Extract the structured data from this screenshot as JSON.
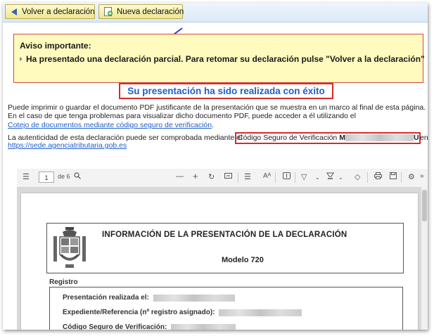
{
  "toolbar": {
    "back_label": "Volver a declaración",
    "new_label": "Nueva declaración"
  },
  "alert": {
    "title": "Aviso importante:",
    "message": "Ha presentado una declaración parcial. Para retomar su declaración pulse \"Volver a la declaración\""
  },
  "success": "Su presentación ha sido realizada con éxito",
  "info": {
    "line1": "Puede imprimir o guardar el documento PDF justificante de la presentación que se muestra en un marco al final de esta página.",
    "line2": "En el caso de que tenga problemas para visualizar dicho documento PDF, puede acceder a él utilizando el",
    "link_cotejo": "Cotejo de documentos mediante código seguro de verificación",
    "period": ".",
    "line3_prefix": "La autenticidad de esta declaración puede ser comprobada mediante el",
    "csv_label": "Código Seguro de Verificación",
    "csv_start": "M",
    "csv_end": "U",
    "line3_suffix": "en",
    "link_sede": "https://sede.agenciatributaria.gob.es"
  },
  "viewer": {
    "page_number": "1",
    "page_total": "de 6"
  },
  "document": {
    "title": "INFORMACIÓN DE LA PRESENTACIÓN DE LA DECLARACIÓN",
    "model": "Modelo 720",
    "section": "Registro",
    "rows": [
      {
        "label": "Presentación realizada el:"
      },
      {
        "label": "Expediente/Referencia (nº registro asignado):"
      },
      {
        "label": "Código Seguro de Verificación:"
      }
    ]
  },
  "colors": {
    "accent_red": "#d62b2b",
    "link_blue": "#1f5fc9",
    "alert_bg": "#fffbbf"
  }
}
